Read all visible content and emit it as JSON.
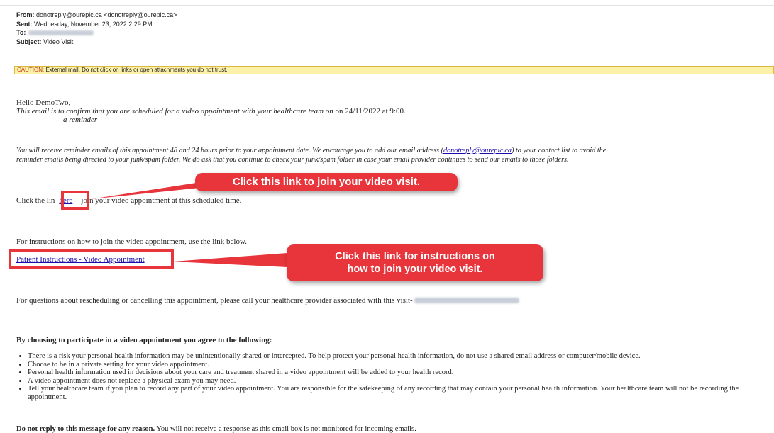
{
  "header": {
    "from_label": "From:",
    "from_value": "donotreply@ourepic.ca <donotreply@ourepic.ca>",
    "sent_label": "Sent:",
    "sent_value": "Wednesday, November 23, 2022 2:29 PM",
    "to_label": "To:",
    "subject_label": "Subject:",
    "subject_value": "Video Visit"
  },
  "caution": {
    "label": "CAUTION:",
    "text": "External mail. Do not click on links or open attachments you do not trust."
  },
  "body": {
    "greeting": "Hello DemoTwo,",
    "confirm_italic": "This email is to confirm that you are scheduled for a video appointment with your healthcare team on",
    "confirm_rest": "on 24/11/2022 at 9:00.",
    "reminder": "a reminder",
    "reminder_para_1": "You will receive reminder emails of this appointment 48 and 24 hours prior to your appointment date.  We encourage you to add our email address (",
    "reminder_email": "donotreply@ourepic.ca",
    "reminder_para_2": ") to your contact list to avoid the",
    "reminder_para_3": "reminder emails being directed to your junk/spam folder.  We do ask that you continue to check your junk/spam folder in case your email provider continues to send our emails to those folders.",
    "click_prefix": "Click the lin",
    "here_link": "here",
    "click_suffix": "join your video appointment at this scheduled time.",
    "instructions_intro": "For instructions on how to join the video appointment, use the link below.",
    "instructions_link": "Patient Instructions - Video Appointment",
    "questions": "For questions about rescheduling or cancelling this appointment, please call your healthcare provider associated with this visit-",
    "agree_heading": "By choosing to participate in a video appointment you agree to the following:",
    "bullets": [
      "There is a risk your personal health information may be unintentionally shared or intercepted. To help protect your personal health information, do not use a shared email address or computer/mobile device.",
      "Choose to be in a private setting for your video appointment.",
      "Personal health information used in decisions about your care and treatment shared in a video appointment will be added to your health record.",
      "A video appointment does not replace a physical exam you may need.",
      "Tell your healthcare team if you plan to record any part of your video appointment. You are responsible for the safekeeping of any recording that may contain your personal health information. Your healthcare team will not be recording the appointment."
    ],
    "noreply_bold": "Do not reply to this message for any reason.",
    "noreply_rest": " You will not receive a response as this email box is not monitored for incoming emails."
  },
  "annotations": {
    "callout_1": "Click this link to join your video visit.",
    "callout_2_line1": "Click this link for instructions on",
    "callout_2_line2": "how to join your video visit.",
    "accent_color": "#e8343b"
  }
}
